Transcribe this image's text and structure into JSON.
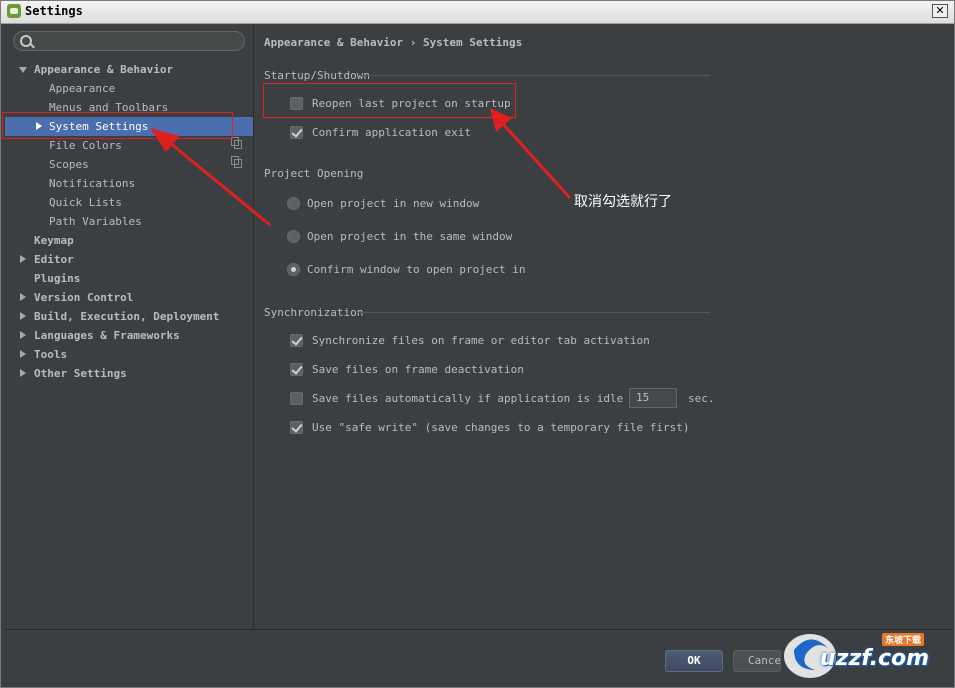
{
  "window": {
    "title": "Settings",
    "close_symbol": "✕"
  },
  "search": {
    "placeholder": ""
  },
  "sidebar": {
    "items": [
      {
        "label": "Appearance & Behavior"
      },
      {
        "label": "Appearance"
      },
      {
        "label": "Menus and Toolbars"
      },
      {
        "label": "System Settings"
      },
      {
        "label": "File Colors"
      },
      {
        "label": "Scopes"
      },
      {
        "label": "Notifications"
      },
      {
        "label": "Quick Lists"
      },
      {
        "label": "Path Variables"
      },
      {
        "label": "Keymap"
      },
      {
        "label": "Editor"
      },
      {
        "label": "Plugins"
      },
      {
        "label": "Version Control"
      },
      {
        "label": "Build, Execution, Deployment"
      },
      {
        "label": "Languages & Frameworks"
      },
      {
        "label": "Tools"
      },
      {
        "label": "Other Settings"
      }
    ]
  },
  "content": {
    "breadcrumb": "Appearance & Behavior › System Settings",
    "startup": {
      "title": "Startup/Shutdown",
      "reopen_last_project": {
        "label": "Reopen last project on startup",
        "checked": false
      },
      "confirm_exit": {
        "label": "Confirm application exit",
        "checked": true
      }
    },
    "project_opening": {
      "title": "Project Opening",
      "options": [
        {
          "label": "Open project in new window",
          "selected": false
        },
        {
          "label": "Open project in the same window",
          "selected": false
        },
        {
          "label": "Confirm window to open project in",
          "selected": true
        }
      ]
    },
    "synchronization": {
      "title": "Synchronization",
      "sync_on_frame": {
        "label": "Synchronize files on frame or editor tab activation",
        "checked": true
      },
      "save_on_deactivation": {
        "label": "Save files on frame deactivation",
        "checked": true
      },
      "save_automatically": {
        "label": "Save files automatically if application is idle for",
        "checked": false,
        "value": "15",
        "unit": "sec."
      },
      "safe_write": {
        "label": "Use \"safe write\" (save changes to a temporary file first)",
        "checked": true
      }
    }
  },
  "footer": {
    "ok_label": "OK",
    "cancel_label": "Cance"
  },
  "annotation": {
    "text": "取消勾选就行了",
    "color": "#e02020"
  },
  "watermark": {
    "text": "uzzf.com",
    "tag": "东坡下载"
  },
  "colors": {
    "background": "#3c3f41",
    "selection": "#4b6eaf",
    "text": "#bbbbbb"
  }
}
